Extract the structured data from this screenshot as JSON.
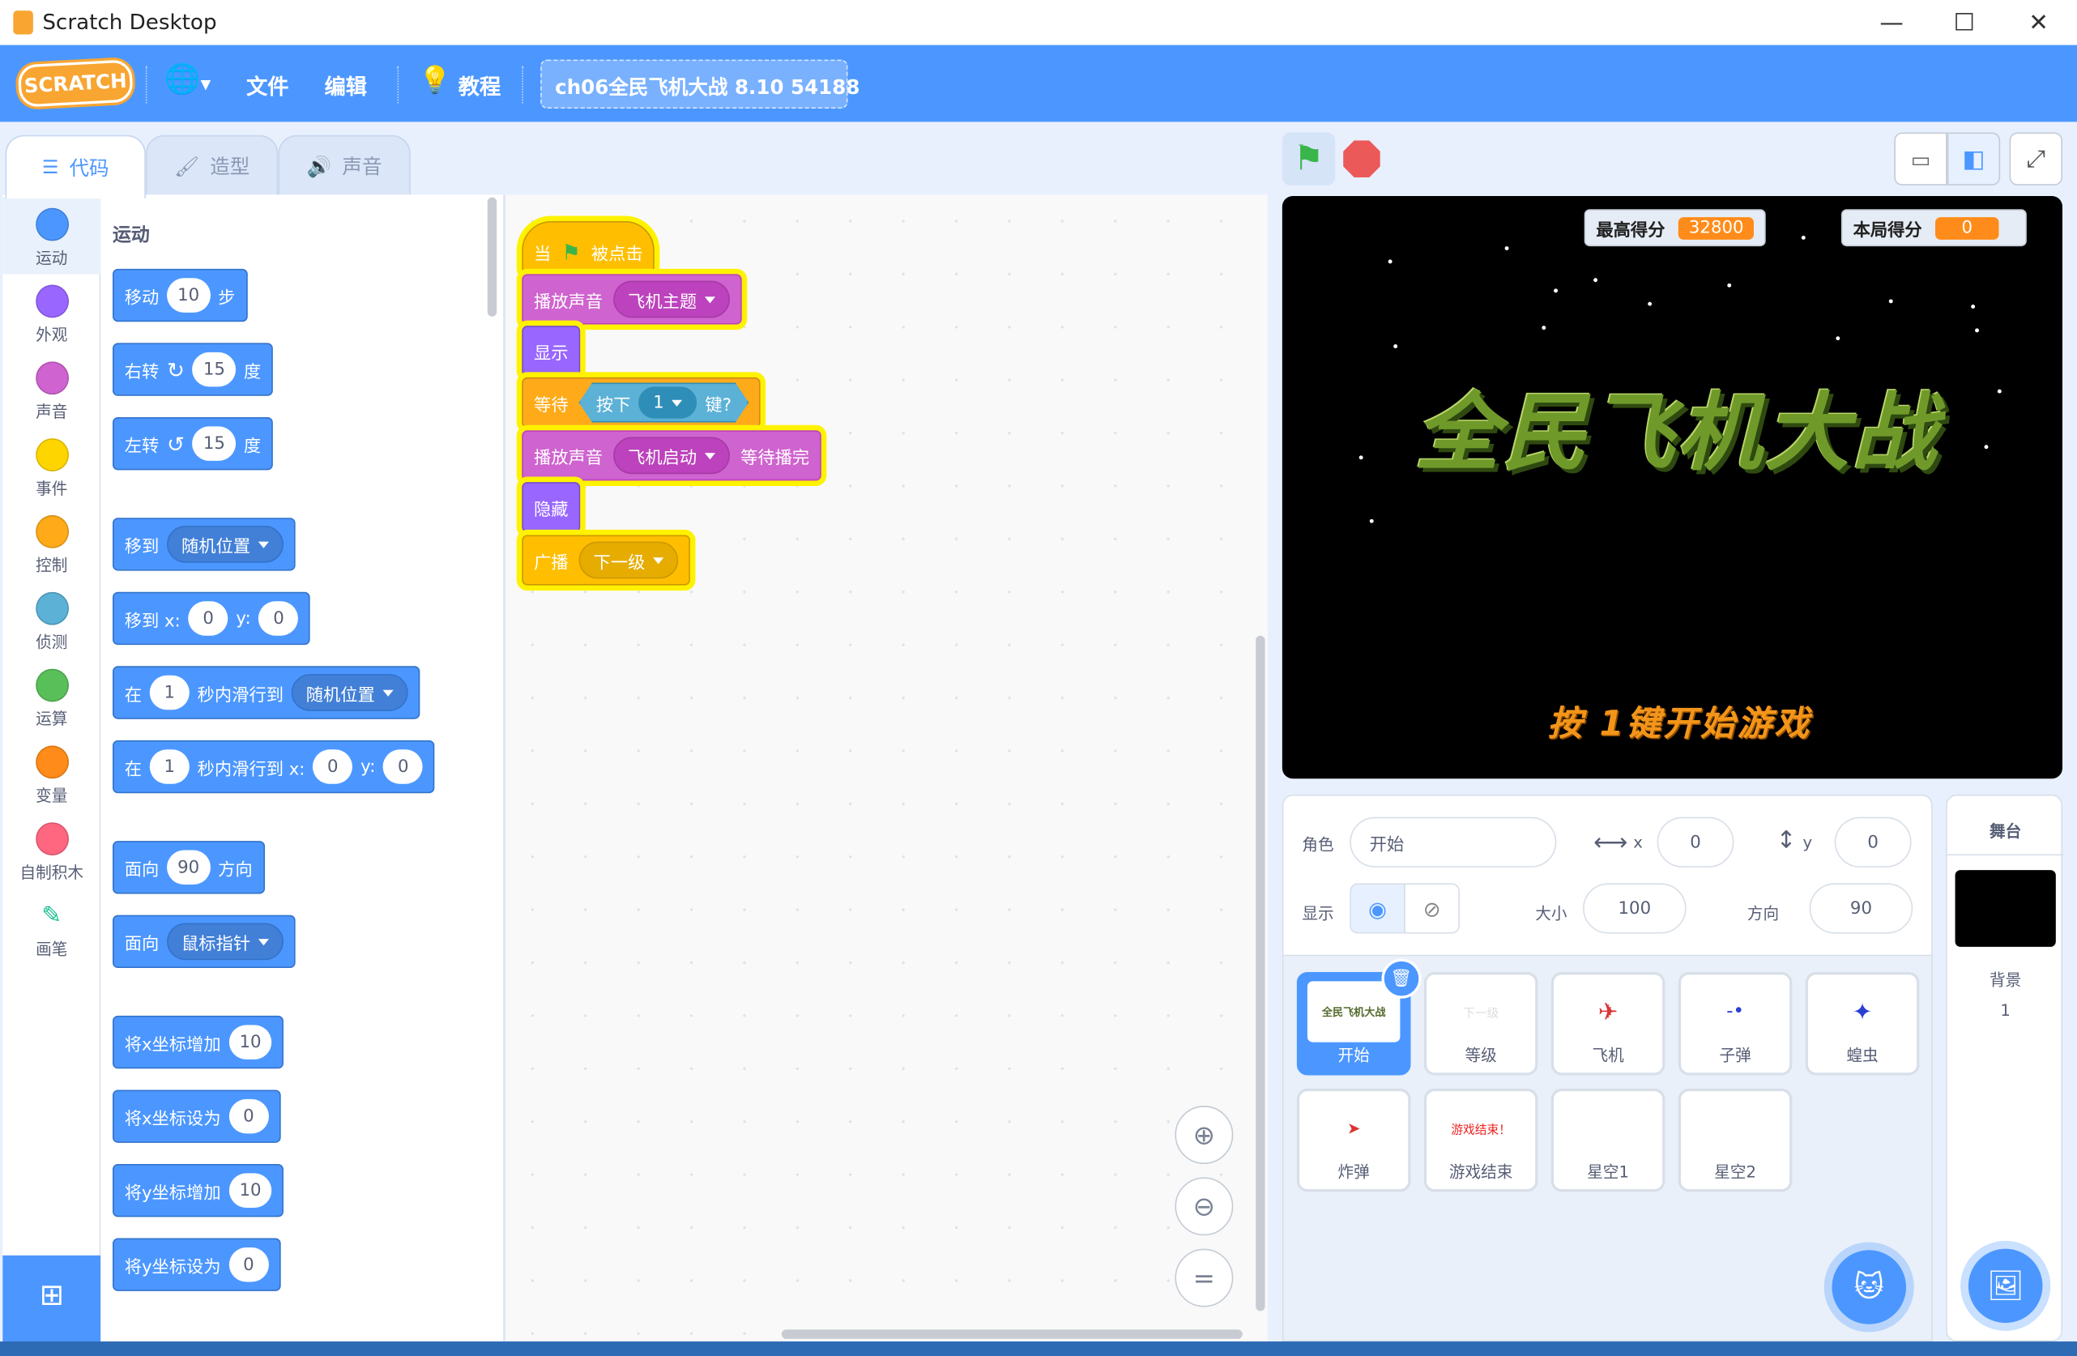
{
  "window": {
    "title": "Scratch Desktop",
    "minimize": "—",
    "maximize": "☐",
    "close": "✕"
  },
  "menubar": {
    "logo": "SCRATCH",
    "file": "文件",
    "edit": "编辑",
    "tutorials": "教程",
    "project_title": "ch06全民飞机大战 8.10 54188"
  },
  "tabs": {
    "code": "代码",
    "costumes": "造型",
    "sounds": "声音"
  },
  "categories": [
    {
      "label": "运动",
      "color": "#4c97ff"
    },
    {
      "label": "外观",
      "color": "#9966ff"
    },
    {
      "label": "声音",
      "color": "#cf63cf"
    },
    {
      "label": "事件",
      "color": "#ffd500"
    },
    {
      "label": "控制",
      "color": "#ffab19"
    },
    {
      "label": "侦测",
      "color": "#5cb1d6"
    },
    {
      "label": "运算",
      "color": "#59c059"
    },
    {
      "label": "变量",
      "color": "#ff8c1a"
    },
    {
      "label": "自制积木",
      "color": "#ff6680"
    },
    {
      "label": "画笔",
      "color": "#0fbd8c"
    }
  ],
  "palette": {
    "heading": "运动",
    "move": {
      "a": "移动",
      "v": "10",
      "b": "步"
    },
    "turn_right": {
      "a": "右转",
      "v": "15",
      "b": "度"
    },
    "turn_left": {
      "a": "左转",
      "v": "15",
      "b": "度"
    },
    "goto": {
      "a": "移到",
      "dd": "随机位置"
    },
    "goto_xy": {
      "a": "移到 x:",
      "x": "0",
      "yl": "y:",
      "y": "0"
    },
    "glide": {
      "a": "在",
      "v": "1",
      "b": "秒内滑行到",
      "dd": "随机位置"
    },
    "glide_xy": {
      "a": "在",
      "v": "1",
      "b": "秒内滑行到 x:",
      "x": "0",
      "yl": "y:",
      "y": "0"
    },
    "point_dir": {
      "a": "面向",
      "v": "90",
      "b": "方向"
    },
    "point_towards": {
      "a": "面向",
      "dd": "鼠标指针"
    },
    "change_x": {
      "a": "将x坐标增加",
      "v": "10"
    },
    "set_x": {
      "a": "将x坐标设为",
      "v": "0"
    },
    "change_y": {
      "a": "将y坐标增加",
      "v": "10"
    },
    "set_y": {
      "a": "将y坐标设为",
      "v": "0"
    }
  },
  "script": {
    "hat": {
      "a": "当",
      "b": "被点击"
    },
    "play1": {
      "a": "播放声音",
      "dd": "飞机主题"
    },
    "show": "显示",
    "wait": {
      "a": "等待",
      "b": "按下",
      "dd": "1",
      "c": "键?"
    },
    "play2": {
      "a": "播放声音",
      "dd": "飞机启动",
      "b": "等待播完"
    },
    "hide": "隐藏",
    "broadcast": {
      "a": "广播",
      "dd": "下一级"
    }
  },
  "stage": {
    "monitor_high": {
      "label": "最高得分",
      "value": "32800"
    },
    "monitor_score": {
      "label": "本局得分",
      "value": "0"
    },
    "title_art": "全民飞机大战",
    "prompt": "按 1键开始游戏"
  },
  "sprite_info": {
    "sprite_label": "角色",
    "sprite_name": "开始",
    "x_label": "x",
    "x": "0",
    "y_label": "y",
    "y": "0",
    "show_label": "显示",
    "size_label": "大小",
    "size": "100",
    "dir_label": "方向",
    "dir": "90"
  },
  "sprites": [
    {
      "name": "开始",
      "thumb": "全民飞机大战"
    },
    {
      "name": "等级",
      "thumb": "下一级"
    },
    {
      "name": "飞机",
      "thumb": ""
    },
    {
      "name": "子弹",
      "thumb": ""
    },
    {
      "name": "蝗虫",
      "thumb": ""
    },
    {
      "name": "炸弹",
      "thumb": ""
    },
    {
      "name": "游戏结束",
      "thumb": "游戏结束！"
    },
    {
      "name": "星空1",
      "thumb": ""
    },
    {
      "name": "星空2",
      "thumb": ""
    }
  ],
  "stage_panel": {
    "title": "舞台",
    "backdrops_label": "背景",
    "backdrops_count": "1"
  }
}
